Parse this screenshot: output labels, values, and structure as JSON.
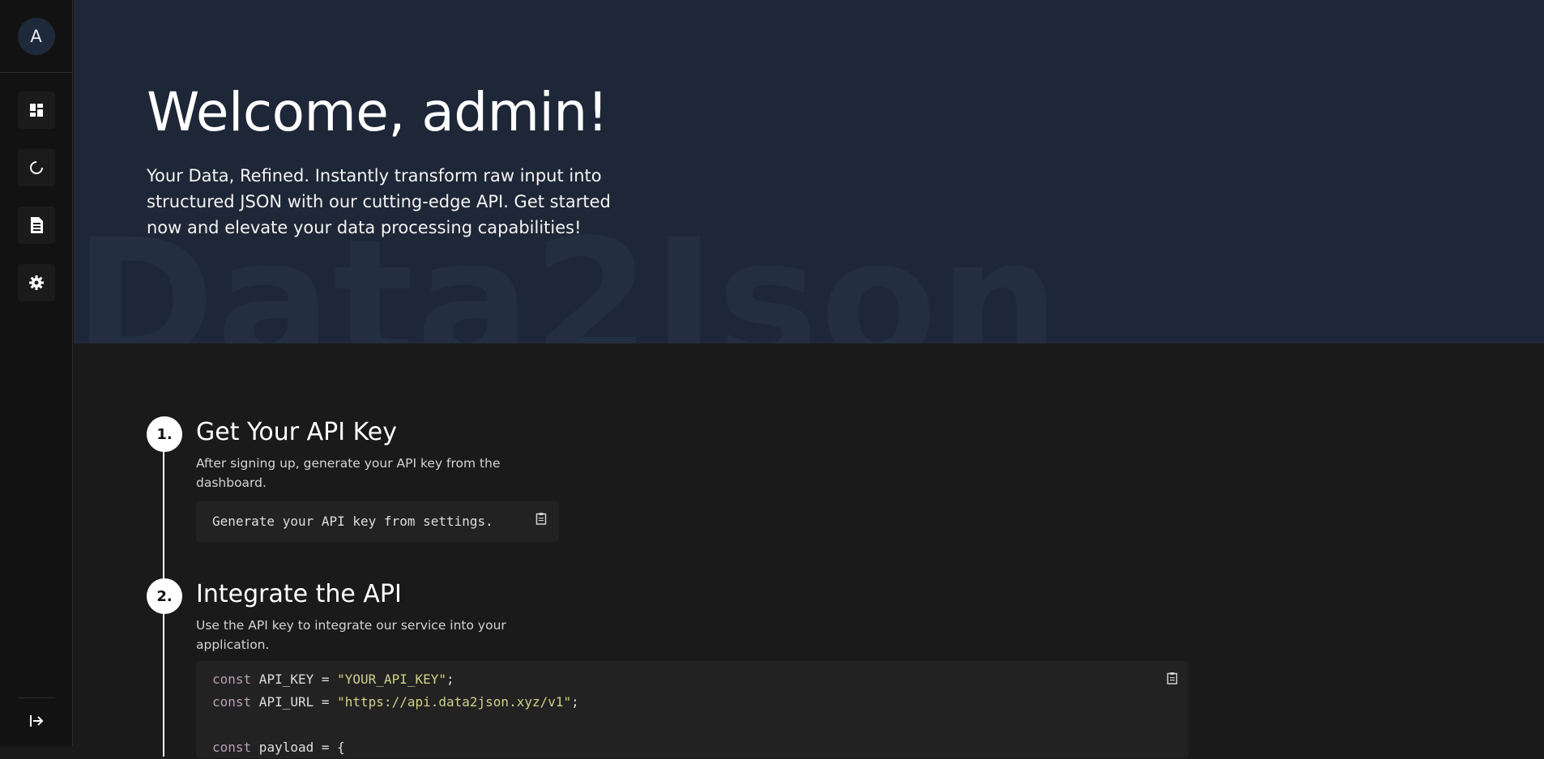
{
  "sidebar": {
    "avatar_letter": "A",
    "items": [
      {
        "name": "dashboard",
        "icon": "dashboard-icon"
      },
      {
        "name": "activity",
        "icon": "loading-circle-icon"
      },
      {
        "name": "docs",
        "icon": "document-icon"
      },
      {
        "name": "settings",
        "icon": "gear-icon"
      }
    ],
    "logout_icon": "logout-icon"
  },
  "hero": {
    "title": "Welcome, admin!",
    "subtitle": "Your Data, Refined. Instantly transform raw input into structured JSON with our cutting-edge API. Get started now and elevate your data processing capabilities!",
    "watermark": "Data2Json"
  },
  "steps": [
    {
      "number": "1.",
      "title": "Get Your API Key",
      "description": "After signing up, generate your API key from the dashboard.",
      "code": "Generate your API key from settings."
    },
    {
      "number": "2.",
      "title": "Integrate the API",
      "description": "Use the API key to integrate our service into your application.",
      "code_lines": [
        {
          "kw": "const",
          "name": " API_KEY = ",
          "str": "\"YOUR_API_KEY\"",
          "end": ";"
        },
        {
          "kw": "const",
          "name": " API_URL = ",
          "str": "\"https://api.data2json.xyz/v1\"",
          "end": ";"
        },
        {
          "kw": "",
          "name": "",
          "str": "",
          "end": ""
        },
        {
          "kw": "const",
          "name": " payload = {",
          "str": "",
          "end": ""
        }
      ]
    }
  ],
  "colors": {
    "hero_bg": "#1e2737",
    "page_bg": "#1a1a1a",
    "sidebar_bg": "#121212",
    "keyword": "#b89fb5",
    "string": "#cfd28a"
  }
}
